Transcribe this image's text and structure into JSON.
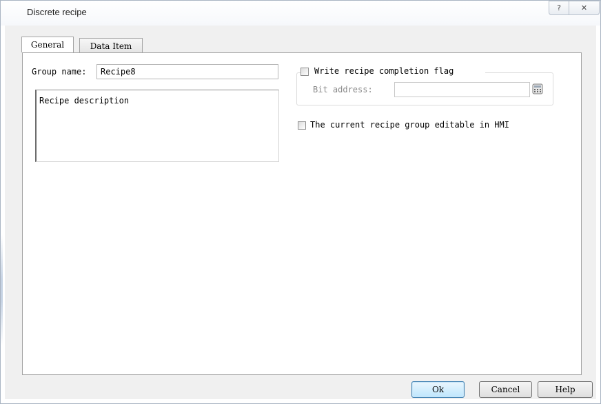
{
  "window": {
    "title": "Discrete recipe",
    "help_button": "?",
    "close_button": "✕"
  },
  "tabs": [
    {
      "label": "General",
      "active": true
    },
    {
      "label": "Data Item",
      "active": false
    }
  ],
  "general": {
    "group_name_label": "Group name:",
    "group_name_value": "Recipe8",
    "description_value": "Recipe description",
    "write_flag": {
      "label": "Write recipe completion flag",
      "checked": false,
      "bit_address_label": "Bit address:",
      "bit_address_value": ""
    },
    "editable_in_hmi": {
      "label": "The current recipe group editable in HMI",
      "checked": false
    }
  },
  "buttons": {
    "ok": "Ok",
    "cancel": "Cancel",
    "help": "Help"
  },
  "icons": {
    "help": "question-mark-icon",
    "close": "close-icon",
    "address_picker": "calculator-icon"
  }
}
